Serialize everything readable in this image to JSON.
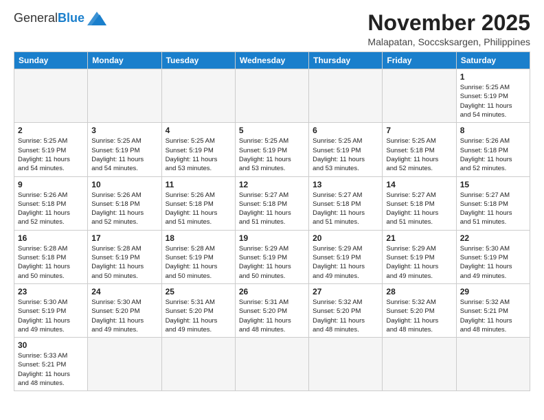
{
  "header": {
    "logo": {
      "general": "General",
      "blue": "Blue"
    },
    "title": "November 2025",
    "location": "Malapatan, Soccsksargen, Philippines"
  },
  "weekdays": [
    "Sunday",
    "Monday",
    "Tuesday",
    "Wednesday",
    "Thursday",
    "Friday",
    "Saturday"
  ],
  "weeks": [
    [
      {
        "day": "",
        "info": ""
      },
      {
        "day": "",
        "info": ""
      },
      {
        "day": "",
        "info": ""
      },
      {
        "day": "",
        "info": ""
      },
      {
        "day": "",
        "info": ""
      },
      {
        "day": "",
        "info": ""
      },
      {
        "day": "1",
        "info": "Sunrise: 5:25 AM\nSunset: 5:19 PM\nDaylight: 11 hours\nand 54 minutes."
      }
    ],
    [
      {
        "day": "2",
        "info": "Sunrise: 5:25 AM\nSunset: 5:19 PM\nDaylight: 11 hours\nand 54 minutes."
      },
      {
        "day": "3",
        "info": "Sunrise: 5:25 AM\nSunset: 5:19 PM\nDaylight: 11 hours\nand 54 minutes."
      },
      {
        "day": "4",
        "info": "Sunrise: 5:25 AM\nSunset: 5:19 PM\nDaylight: 11 hours\nand 53 minutes."
      },
      {
        "day": "5",
        "info": "Sunrise: 5:25 AM\nSunset: 5:19 PM\nDaylight: 11 hours\nand 53 minutes."
      },
      {
        "day": "6",
        "info": "Sunrise: 5:25 AM\nSunset: 5:19 PM\nDaylight: 11 hours\nand 53 minutes."
      },
      {
        "day": "7",
        "info": "Sunrise: 5:25 AM\nSunset: 5:18 PM\nDaylight: 11 hours\nand 52 minutes."
      },
      {
        "day": "8",
        "info": "Sunrise: 5:26 AM\nSunset: 5:18 PM\nDaylight: 11 hours\nand 52 minutes."
      }
    ],
    [
      {
        "day": "9",
        "info": "Sunrise: 5:26 AM\nSunset: 5:18 PM\nDaylight: 11 hours\nand 52 minutes."
      },
      {
        "day": "10",
        "info": "Sunrise: 5:26 AM\nSunset: 5:18 PM\nDaylight: 11 hours\nand 52 minutes."
      },
      {
        "day": "11",
        "info": "Sunrise: 5:26 AM\nSunset: 5:18 PM\nDaylight: 11 hours\nand 51 minutes."
      },
      {
        "day": "12",
        "info": "Sunrise: 5:27 AM\nSunset: 5:18 PM\nDaylight: 11 hours\nand 51 minutes."
      },
      {
        "day": "13",
        "info": "Sunrise: 5:27 AM\nSunset: 5:18 PM\nDaylight: 11 hours\nand 51 minutes."
      },
      {
        "day": "14",
        "info": "Sunrise: 5:27 AM\nSunset: 5:18 PM\nDaylight: 11 hours\nand 51 minutes."
      },
      {
        "day": "15",
        "info": "Sunrise: 5:27 AM\nSunset: 5:18 PM\nDaylight: 11 hours\nand 51 minutes."
      }
    ],
    [
      {
        "day": "16",
        "info": "Sunrise: 5:28 AM\nSunset: 5:18 PM\nDaylight: 11 hours\nand 50 minutes."
      },
      {
        "day": "17",
        "info": "Sunrise: 5:28 AM\nSunset: 5:19 PM\nDaylight: 11 hours\nand 50 minutes."
      },
      {
        "day": "18",
        "info": "Sunrise: 5:28 AM\nSunset: 5:19 PM\nDaylight: 11 hours\nand 50 minutes."
      },
      {
        "day": "19",
        "info": "Sunrise: 5:29 AM\nSunset: 5:19 PM\nDaylight: 11 hours\nand 50 minutes."
      },
      {
        "day": "20",
        "info": "Sunrise: 5:29 AM\nSunset: 5:19 PM\nDaylight: 11 hours\nand 49 minutes."
      },
      {
        "day": "21",
        "info": "Sunrise: 5:29 AM\nSunset: 5:19 PM\nDaylight: 11 hours\nand 49 minutes."
      },
      {
        "day": "22",
        "info": "Sunrise: 5:30 AM\nSunset: 5:19 PM\nDaylight: 11 hours\nand 49 minutes."
      }
    ],
    [
      {
        "day": "23",
        "info": "Sunrise: 5:30 AM\nSunset: 5:19 PM\nDaylight: 11 hours\nand 49 minutes."
      },
      {
        "day": "24",
        "info": "Sunrise: 5:30 AM\nSunset: 5:20 PM\nDaylight: 11 hours\nand 49 minutes."
      },
      {
        "day": "25",
        "info": "Sunrise: 5:31 AM\nSunset: 5:20 PM\nDaylight: 11 hours\nand 49 minutes."
      },
      {
        "day": "26",
        "info": "Sunrise: 5:31 AM\nSunset: 5:20 PM\nDaylight: 11 hours\nand 48 minutes."
      },
      {
        "day": "27",
        "info": "Sunrise: 5:32 AM\nSunset: 5:20 PM\nDaylight: 11 hours\nand 48 minutes."
      },
      {
        "day": "28",
        "info": "Sunrise: 5:32 AM\nSunset: 5:20 PM\nDaylight: 11 hours\nand 48 minutes."
      },
      {
        "day": "29",
        "info": "Sunrise: 5:32 AM\nSunset: 5:21 PM\nDaylight: 11 hours\nand 48 minutes."
      }
    ],
    [
      {
        "day": "30",
        "info": "Sunrise: 5:33 AM\nSunset: 5:21 PM\nDaylight: 11 hours\nand 48 minutes."
      },
      {
        "day": "",
        "info": ""
      },
      {
        "day": "",
        "info": ""
      },
      {
        "day": "",
        "info": ""
      },
      {
        "day": "",
        "info": ""
      },
      {
        "day": "",
        "info": ""
      },
      {
        "day": "",
        "info": ""
      }
    ]
  ]
}
